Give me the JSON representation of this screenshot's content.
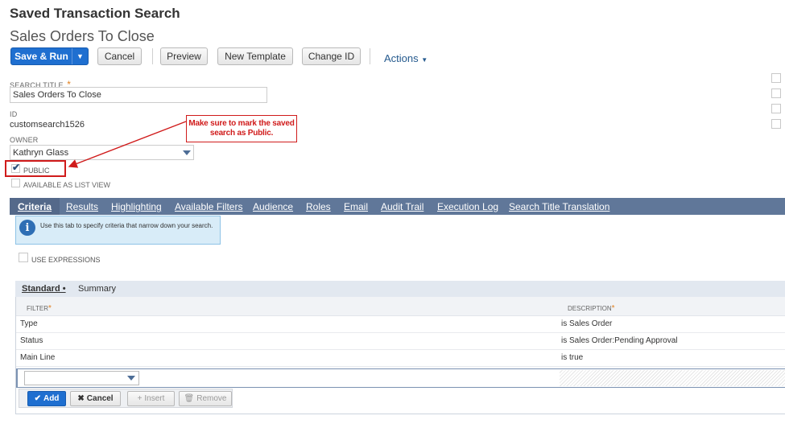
{
  "header": {
    "page_type": "Saved Transaction Search",
    "record_title": "Sales Orders To Close"
  },
  "toolbar": {
    "save_run_label": "Save & Run",
    "cancel_label": "Cancel",
    "preview_label": "Preview",
    "new_template_label": "New Template",
    "change_id_label": "Change ID",
    "actions_label": "Actions"
  },
  "form": {
    "search_title_label": "SEARCH TITLE",
    "search_title_value": "Sales Orders To Close",
    "id_label": "ID",
    "id_value": "customsearch1526",
    "owner_label": "OWNER",
    "owner_value": "Kathryn Glass",
    "public_label": "PUBLIC",
    "public_checked": true,
    "list_view_label": "AVAILABLE AS LIST VIEW",
    "list_view_checked": false
  },
  "annotation": {
    "callout_text": "Make sure to mark the saved search as Public.",
    "color": "#d01b1b"
  },
  "tabs": [
    {
      "label": "Criteria",
      "active": true
    },
    {
      "label": "Results"
    },
    {
      "label": "Highlighting"
    },
    {
      "label": "Available Filters"
    },
    {
      "label": "Audience"
    },
    {
      "label": "Roles"
    },
    {
      "label": "Email"
    },
    {
      "label": "Audit Trail"
    },
    {
      "label": "Execution Log"
    },
    {
      "label": "Search Title Translation"
    }
  ],
  "info": {
    "text": "Use this tab to specify criteria that narrow down your search."
  },
  "criteria": {
    "use_expressions_label": "USE EXPRESSIONS",
    "subtabs": [
      {
        "label": "Standard •",
        "active": true
      },
      {
        "label": "Summary"
      }
    ],
    "columns": {
      "filter": "FILTER",
      "description": "DESCRIPTION"
    },
    "rows": [
      {
        "filter": "Type",
        "description": "is Sales Order"
      },
      {
        "filter": "Status",
        "description": "is Sales Order:Pending Approval"
      },
      {
        "filter": "Main Line",
        "description": "is true"
      }
    ],
    "buttons": {
      "add": "Add",
      "cancel": "Cancel",
      "insert": "Insert",
      "remove": "Remove"
    }
  },
  "colors": {
    "primary_button": "#1f6fd0",
    "tab_bar": "#607799",
    "accent_link": "#255a8e"
  }
}
